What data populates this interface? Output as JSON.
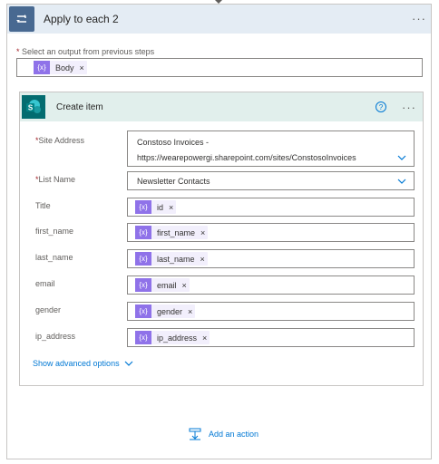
{
  "loop": {
    "title": "Apply to each 2",
    "more_label": "···",
    "output_label_req": "*",
    "output_label": "Select an output from previous steps",
    "output_token": "Body"
  },
  "action": {
    "title": "Create item",
    "help_label": "?",
    "more_label": "···",
    "fields": {
      "site_address": {
        "req": "*",
        "label": "Site Address",
        "value_line1": "Constoso Invoices -",
        "value_line2": "https://wearepowergi.sharepoint.com/sites/ConstosoInvoices"
      },
      "list_name": {
        "req": "*",
        "label": "List Name",
        "value": "Newsletter Contacts"
      },
      "title": {
        "label": "Title",
        "token": "id"
      },
      "first_name": {
        "label": "first_name",
        "token": "first_name"
      },
      "last_name": {
        "label": "last_name",
        "token": "last_name"
      },
      "email": {
        "label": "email",
        "token": "email"
      },
      "gender": {
        "label": "gender",
        "token": "gender"
      },
      "ip_address": {
        "label": "ip_address",
        "token": "ip_address"
      }
    },
    "advanced_label": "Show advanced options"
  },
  "footer": {
    "add_action_label": "Add an action"
  },
  "token_remove": "×",
  "colors": {
    "loop_header": "#e4ecf4",
    "loop_icon": "#486991",
    "sharepoint_header": "#e1efec",
    "sharepoint_icon": "#036c70",
    "token_icon": "#8f72e9",
    "link": "#0078d4"
  }
}
